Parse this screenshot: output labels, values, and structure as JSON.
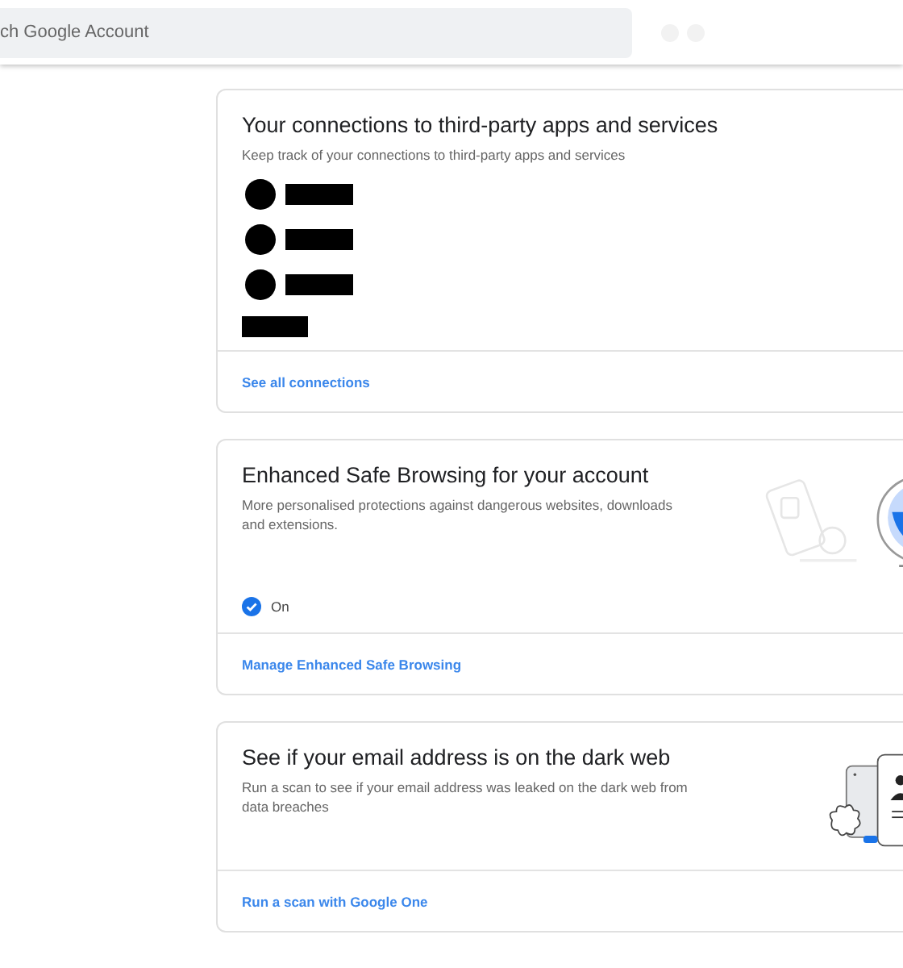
{
  "header": {
    "search": {
      "placeholder": "ch Google Account"
    }
  },
  "cards": [
    {
      "kind": "connections",
      "title": "Your connections to third-party apps and services",
      "description": "Keep track of your connections to third-party apps and services",
      "link": "See all connections"
    },
    {
      "kind": "safe_browsing",
      "title": "Enhanced Safe Browsing for your account",
      "description": "More personalised protections against dangerous websites, downloads and extensions.",
      "status": {
        "label": "On",
        "on": true
      },
      "link": "Manage Enhanced Safe Browsing"
    },
    {
      "kind": "dark_web",
      "title": "See if your email address is on the dark web",
      "description": "Run a scan to see if your email address was leaked on the dark web from data breaches",
      "link": "Run a scan with Google One"
    }
  ]
}
